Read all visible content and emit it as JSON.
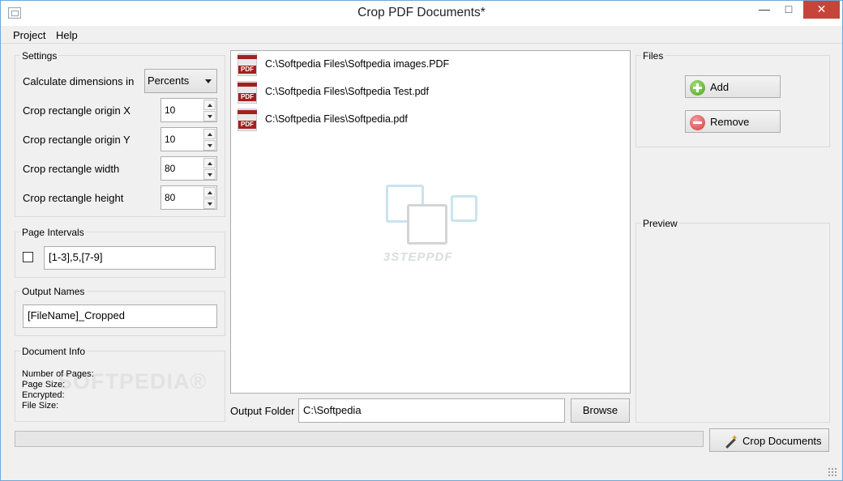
{
  "window": {
    "title": "Crop PDF Documents*",
    "min_glyph": "—",
    "max_glyph": "□",
    "close_glyph": "✕"
  },
  "menu": {
    "items": [
      "Project",
      "Help"
    ]
  },
  "settings": {
    "title": "Settings",
    "calc_label": "Calculate dimensions in",
    "calc_value": "Percents",
    "origin_x_label": "Crop rectangle origin X",
    "origin_x_value": "10",
    "origin_y_label": "Crop rectangle origin Y",
    "origin_y_value": "10",
    "width_label": "Crop rectangle width",
    "width_value": "80",
    "height_label": "Crop rectangle height",
    "height_value": "80"
  },
  "page_intervals": {
    "title": "Page Intervals",
    "checked": false,
    "value": "[1-3],5,[7-9]"
  },
  "output_names": {
    "title": "Output Names",
    "value": "[FileName]_Cropped"
  },
  "document_info": {
    "title": "Document Info",
    "number_of_pages": "Number of Pages:",
    "page_size": "Page Size:",
    "encrypted": "Encrypted:",
    "file_size": "File Size:"
  },
  "files_list": {
    "items": [
      {
        "path": "C:\\Softpedia Files\\Softpedia images.PDF",
        "icon": "pdf-file-icon"
      },
      {
        "path": "C:\\Softpedia Files\\Softpedia Test.pdf",
        "icon": "pdf-file-icon"
      },
      {
        "path": "C:\\Softpedia Files\\Softpedia.pdf",
        "icon": "pdf-file-icon"
      }
    ],
    "pdf_badge": "PDF",
    "watermark_text": "3STEPPDF"
  },
  "output_folder": {
    "label": "Output Folder",
    "value": "C:\\Softpedia",
    "browse_label": "Browse"
  },
  "files_group": {
    "title": "Files",
    "add_label": "Add",
    "remove_label": "Remove"
  },
  "preview": {
    "title": "Preview"
  },
  "crop_button": {
    "label": "Crop Documents"
  },
  "progress": {
    "value": 0
  },
  "watermark": {
    "softpedia": "SOFTPEDIA®"
  },
  "colors": {
    "pdf_red": "#a3201f",
    "close_red": "#c7443a",
    "add_green": "#4aa125",
    "remove_red": "#d03a3a"
  }
}
